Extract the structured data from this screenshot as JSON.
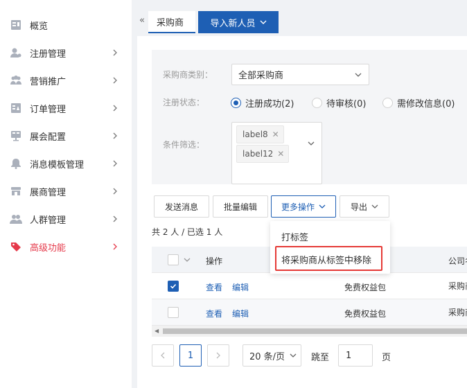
{
  "sidebar": {
    "items": [
      {
        "label": "概览",
        "icon": "overview-icon"
      },
      {
        "label": "注册管理",
        "icon": "register-user-icon"
      },
      {
        "label": "营销推广",
        "icon": "marketing-people-icon"
      },
      {
        "label": "订单管理",
        "icon": "order-icon"
      },
      {
        "label": "展会配置",
        "icon": "exhibition-config-icon"
      },
      {
        "label": "消息模板管理",
        "icon": "bell-icon"
      },
      {
        "label": "展商管理",
        "icon": "exhibitor-shop-icon"
      },
      {
        "label": "人群管理",
        "icon": "crowd-icon"
      },
      {
        "label": "高级功能",
        "icon": "tag-icon"
      }
    ]
  },
  "collapse_glyph": "«",
  "tabs": {
    "active": "采购商",
    "import": "导入新人员"
  },
  "filters": {
    "category_label": "采购商类别：",
    "category_value": "全部采购商",
    "status_label": "注册状态：",
    "status_options": [
      "注册成功(2)",
      "待审核(0)",
      "需修改信息(0)"
    ],
    "status_selected": 0,
    "condition_label": "条件筛选：",
    "tags": [
      "label8",
      "label12"
    ]
  },
  "actions": {
    "send": "发送消息",
    "batch_edit": "批量编辑",
    "more": "更多操作",
    "export": "导出"
  },
  "dropdown": {
    "items": [
      "打标签",
      "将采购商从标签中移除"
    ]
  },
  "summary": "共 2 人 / 已选 1 人",
  "table": {
    "headers": {
      "operation": "操作",
      "company": "公司名"
    },
    "rows": [
      {
        "checked": true,
        "view": "查看",
        "edit": "编辑",
        "package": "免费权益包",
        "company": "采购商"
      },
      {
        "checked": false,
        "view": "查看",
        "edit": "编辑",
        "package": "免费权益包",
        "company": "采购商"
      }
    ]
  },
  "pagination": {
    "current": "1",
    "page_size": "20 条/页",
    "jump_label": "跳至",
    "jump_value": "1",
    "page_unit": "页"
  },
  "colors": {
    "primary": "#1e5fb4",
    "active_red": "#e5394a",
    "highlight_red": "#e53935"
  }
}
